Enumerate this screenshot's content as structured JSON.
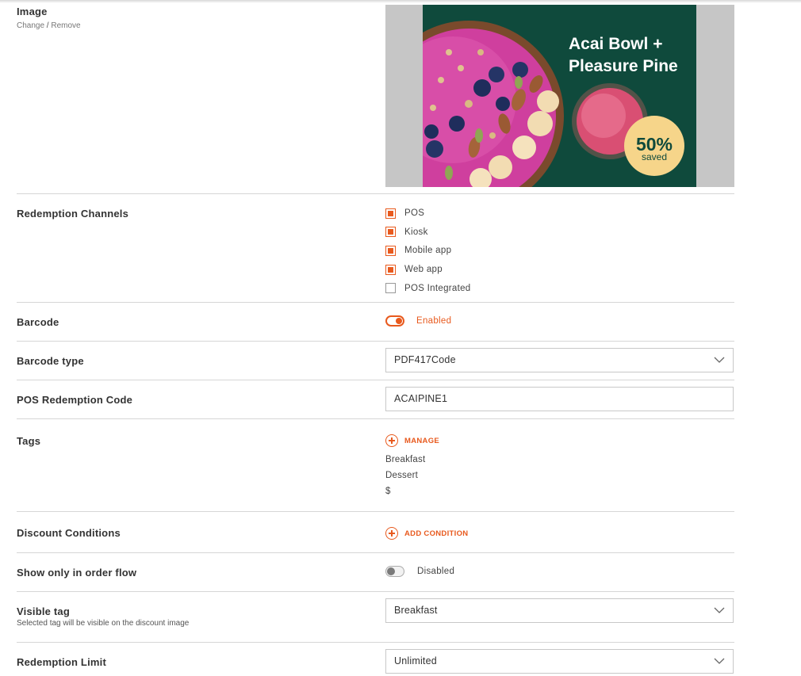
{
  "image_section": {
    "label": "Image",
    "change_link": "Change",
    "separator": " / ",
    "remove_link": "Remove",
    "promo": {
      "headline_line1": "Acai Bowl +",
      "headline_line2": "Pleasure Pine",
      "badge_value": "50%",
      "badge_caption": "saved"
    }
  },
  "redemption_channels": {
    "label": "Redemption Channels",
    "options": [
      {
        "label": "POS",
        "checked": true
      },
      {
        "label": "Kiosk",
        "checked": true
      },
      {
        "label": "Mobile app",
        "checked": true
      },
      {
        "label": "Web app",
        "checked": true
      },
      {
        "label": "POS Integrated",
        "checked": false
      }
    ]
  },
  "barcode": {
    "label": "Barcode",
    "status": "Enabled",
    "enabled": true
  },
  "barcode_type": {
    "label": "Barcode type",
    "value": "PDF417Code"
  },
  "pos_redemption_code": {
    "label": "POS Redemption Code",
    "value": "ACAIPINE1"
  },
  "tags": {
    "label": "Tags",
    "manage_label": "MANAGE",
    "items": [
      "Breakfast",
      "Dessert",
      "$"
    ]
  },
  "discount_conditions": {
    "label": "Discount Conditions",
    "add_label": "ADD CONDITION"
  },
  "show_only_in_order_flow": {
    "label": "Show only in order flow",
    "status": "Disabled",
    "enabled": false
  },
  "visible_tag": {
    "label": "Visible tag",
    "help": "Selected tag will be visible on the discount image",
    "value": "Breakfast"
  },
  "redemption_limit": {
    "label": "Redemption Limit",
    "value": "Unlimited"
  },
  "colors": {
    "accent": "#e85a1e",
    "promo_bg": "#0f4a3c",
    "badge": "#f6d58a"
  }
}
